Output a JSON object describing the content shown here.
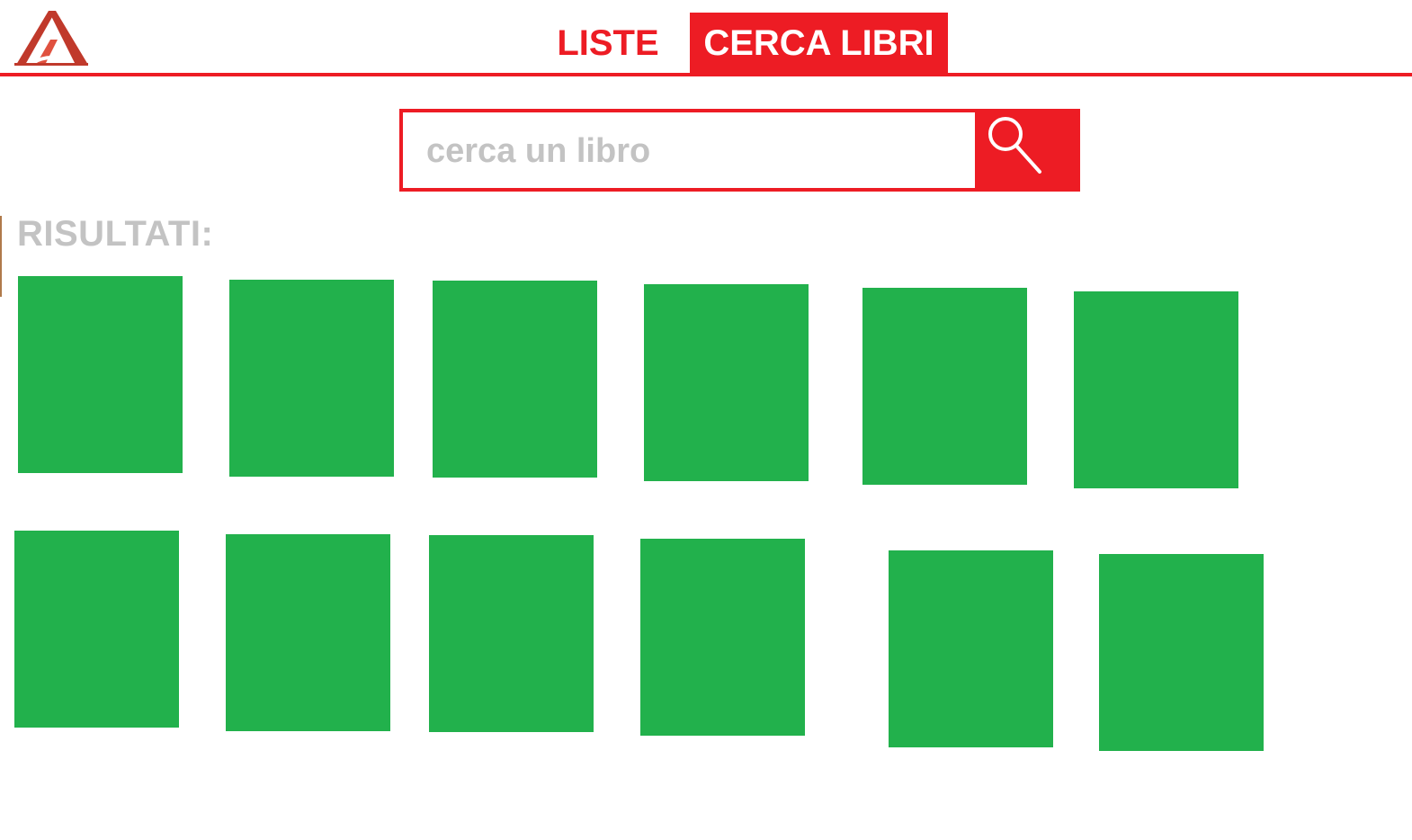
{
  "header": {
    "logo_icon": "library-logo-icon",
    "tabs": [
      {
        "label": "LISTE",
        "active": false
      },
      {
        "label": "CERCA LIBRI",
        "active": true
      }
    ]
  },
  "search": {
    "placeholder": "cerca un libro",
    "value": "",
    "button_icon": "magnifier-icon"
  },
  "results": {
    "label": "RISULTATI:",
    "items": [
      {
        "kind": "book-cover"
      },
      {
        "kind": "book-cover"
      },
      {
        "kind": "book-cover"
      },
      {
        "kind": "book-cover"
      },
      {
        "kind": "book-cover"
      },
      {
        "kind": "book-cover"
      },
      {
        "kind": "book-cover"
      },
      {
        "kind": "book-cover"
      },
      {
        "kind": "book-cover"
      },
      {
        "kind": "book-cover"
      },
      {
        "kind": "book-cover"
      },
      {
        "kind": "book-cover"
      }
    ]
  },
  "colors": {
    "accent": "#ed1c24",
    "cover": "#22b14c",
    "muted_text": "#c3c3c3"
  }
}
